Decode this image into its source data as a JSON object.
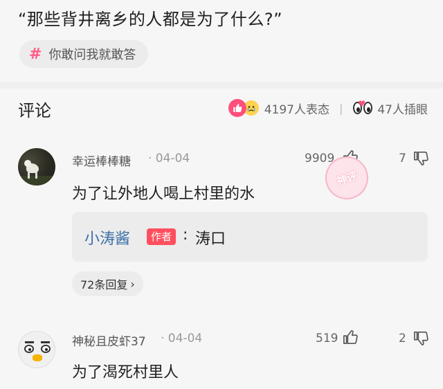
{
  "post": {
    "title": "“那些背井离乡的人都是为了什么?”",
    "topic_hash": "#",
    "topic_label": "你敢问我就敢答"
  },
  "comments_header": {
    "title": "评论",
    "reactions_count": "4197人表态",
    "separator": "|",
    "watching_count": "47人插眼"
  },
  "comments": [
    {
      "username": "幸运棒棒糖",
      "date": "· 04-04",
      "likes": "9909",
      "dislikes": "7",
      "text": "为了让外地人喝上村里的水",
      "stamp": "神评",
      "reply": {
        "username": "小涛酱",
        "badge": "作者",
        "separator": ":",
        "text": "涛口"
      },
      "view_replies": "72条回复",
      "chevron": "›"
    },
    {
      "username": "神秘且皮虾37",
      "date": "· 04-04",
      "likes": "519",
      "dislikes": "2",
      "text": "为了渴死村里人"
    }
  ],
  "icons": {
    "like_reaction": "thumbs-up-icon",
    "cry_reaction": "crying-face-icon",
    "watching": "eyes-icon",
    "like": "thumbs-up-outline-icon",
    "dislike": "thumbs-down-outline-icon"
  },
  "colors": {
    "accent_pink": "#ff4f7b",
    "author_badge": "#ff4f5e",
    "reply_user_blue": "#3b6fa8"
  }
}
